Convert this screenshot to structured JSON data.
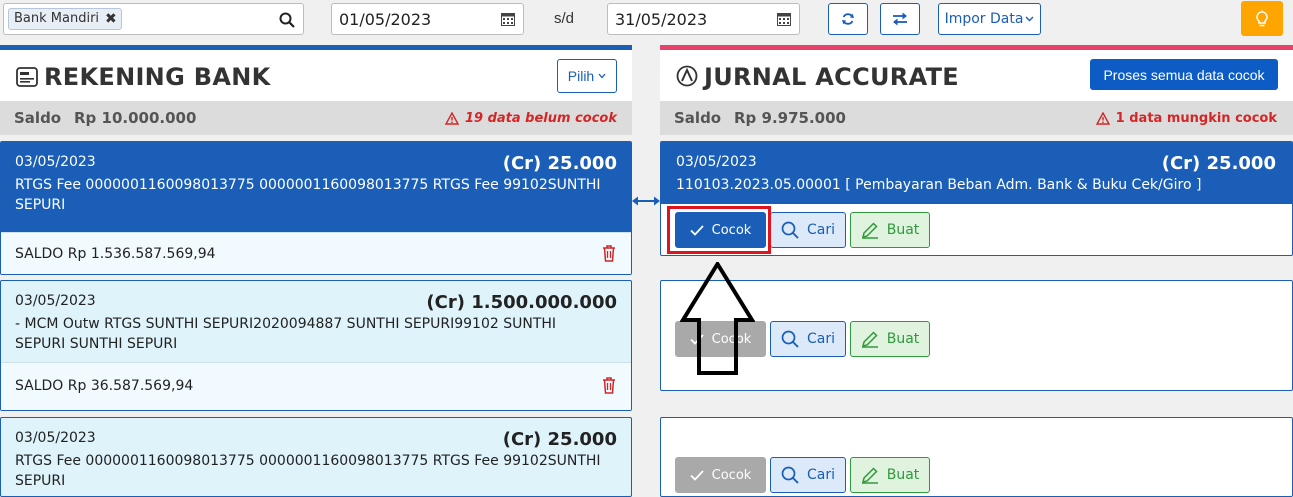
{
  "toolbar": {
    "bank_chip": "Bank Mandiri",
    "date_from": "01/05/2023",
    "separator": "s/d",
    "date_to": "31/05/2023",
    "import_label": "Impor Data"
  },
  "left": {
    "title": "REKENING BANK",
    "pilih_label": "Pilih",
    "saldo_label": "Saldo",
    "saldo_value": "Rp 10.000.000",
    "warning": "19 data belum cocok",
    "items": [
      {
        "date": "03/05/2023",
        "amount": "(Cr) 25.000",
        "desc": "RTGS Fee 0000001160098013775 0000001160098013775 RTGS Fee 99102SUNTHI SEPURI",
        "saldo": "SALDO Rp 1.536.587.569,94"
      },
      {
        "date": "03/05/2023",
        "amount": "(Cr) 1.500.000.000",
        "desc": "- MCM Outw RTGS SUNTHI SEPURI2020094887 SUNTHI SEPURI99102 SUNTHI SEPURI SUNTHI SEPURI",
        "saldo": "SALDO Rp 36.587.569,94"
      },
      {
        "date": "03/05/2023",
        "amount": "(Cr) 25.000",
        "desc": "RTGS Fee 0000001160098013775 0000001160098013775 RTGS Fee 99102SUNTHI SEPURI"
      }
    ]
  },
  "right": {
    "title": "JURNAL ACCURATE",
    "process_label": "Proses semua data cocok",
    "saldo_label": "Saldo",
    "saldo_value": "Rp 9.975.000",
    "warning": "1 data mungkin cocok",
    "journal": {
      "date": "03/05/2023",
      "amount": "(Cr) 25.000",
      "desc": "110103.2023.05.00001 [ Pembayaran Beban Adm. Bank & Buku Cek/Giro ]"
    },
    "cocok_label": "Cocok",
    "cari_label": "Cari",
    "buat_label": "Buat"
  },
  "colors": {
    "primary": "#1a5eb8",
    "accent_red": "#e8426b",
    "warning": "#d32626",
    "bulb": "#ffa500",
    "highlight_box": "#e0141e"
  }
}
